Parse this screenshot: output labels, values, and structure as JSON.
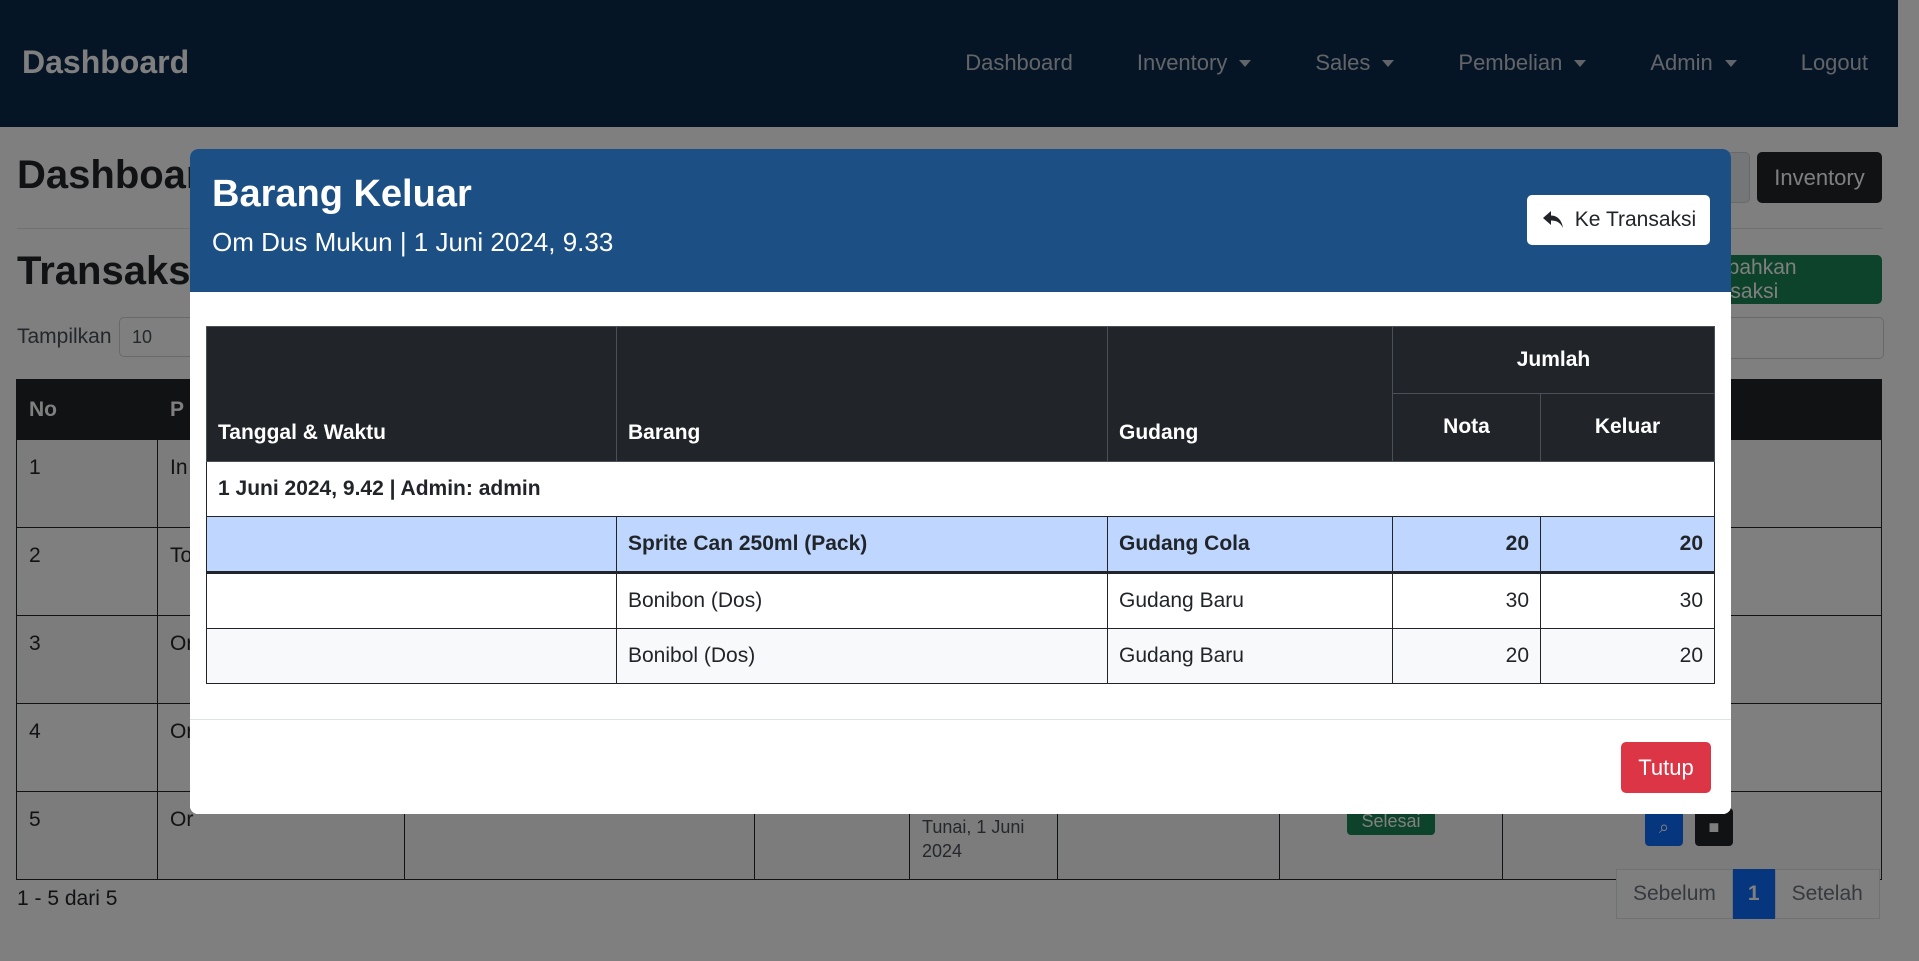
{
  "navbar": {
    "brand": "Dashboard",
    "items": [
      {
        "label": "Dashboard",
        "dropdown": false
      },
      {
        "label": "Inventory",
        "dropdown": true
      },
      {
        "label": "Sales",
        "dropdown": true
      },
      {
        "label": "Pembelian",
        "dropdown": true
      },
      {
        "label": "Admin",
        "dropdown": true
      },
      {
        "label": "Logout",
        "dropdown": false
      }
    ]
  },
  "page": {
    "title": "Dashboard",
    "inventory_button": "Inventory",
    "section_title": "Transaksi",
    "add_button": "Tambahkan Transaksi",
    "show_label": "Tampilkan",
    "show_value": "10",
    "columns": [
      "No",
      "P"
    ],
    "rows": [
      {
        "no": "1",
        "p": "In"
      },
      {
        "no": "2",
        "p": "To"
      },
      {
        "no": "3",
        "p": "Or"
      },
      {
        "no": "4",
        "p": "Or"
      },
      {
        "no": "5",
        "p": "Or"
      }
    ],
    "row5_payment": "Tunai, 1 Juni 2024",
    "row5_status": "Selesai",
    "pager_info": "1 - 5 dari 5",
    "pager": {
      "prev": "Sebelum",
      "current": "1",
      "next": "Setelah"
    }
  },
  "modal": {
    "title": "Barang Keluar",
    "subtitle": "Om Dus Mukun | 1 Juni 2024, 9.33",
    "transaksi_button": "Ke Transaksi",
    "close_button": "Tutup",
    "table": {
      "headers": {
        "datetime": "Tanggal & Waktu",
        "item": "Barang",
        "warehouse": "Gudang",
        "amount": "Jumlah",
        "nota": "Nota",
        "keluar": "Keluar"
      },
      "group_label": "1 Juni 2024, 9.42 | Admin: admin",
      "rows": [
        {
          "item": "Sprite Can 250ml (Pack)",
          "warehouse": "Gudang Cola",
          "nota": "20",
          "keluar": "20"
        },
        {
          "item": "Bonibon (Dos)",
          "warehouse": "Gudang Baru",
          "nota": "30",
          "keluar": "30"
        },
        {
          "item": "Bonibol (Dos)",
          "warehouse": "Gudang Baru",
          "nota": "20",
          "keluar": "20"
        }
      ]
    }
  },
  "colors": {
    "navbar": "#0d2a4a",
    "modal_header": "#1c4f84",
    "highlight_row": "#bfd7ff",
    "danger": "#dc3545",
    "success": "#198754"
  }
}
